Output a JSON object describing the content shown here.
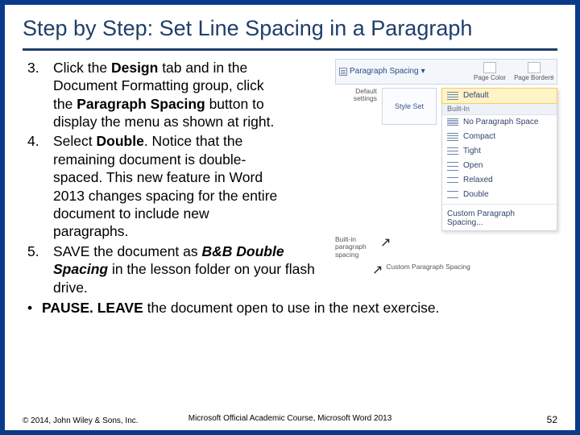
{
  "title": "Step by Step: Set Line Spacing in a Paragraph",
  "steps": [
    {
      "num": "3.",
      "segments": [
        {
          "t": "Click the "
        },
        {
          "t": "Design",
          "b": true
        },
        {
          "t": " tab and in the Document Formatting group, click the "
        },
        {
          "t": "Paragraph Spacing",
          "b": true
        },
        {
          "t": " button to display the menu as shown at right."
        }
      ],
      "narrow": true
    },
    {
      "num": "4.",
      "segments": [
        {
          "t": "Select "
        },
        {
          "t": "Double",
          "b": true
        },
        {
          "t": ". Notice that the remaining document is double-spaced. This new feature in Word 2013 changes spacing for the entire document to include new paragraphs."
        }
      ],
      "narrow": true
    },
    {
      "num": "5.",
      "segments": [
        {
          "t": " SAVE the document as "
        },
        {
          "t": "B&B Double Spacing",
          "bi": true
        },
        {
          "t": " in the lesson folder on your flash drive."
        }
      ],
      "narrow": false
    }
  ],
  "pause_segments": [
    {
      "t": "PAUSE. LEAVE ",
      "b": true
    },
    {
      "t": "the document open to use in the next exercise."
    }
  ],
  "footer": {
    "left": "© 2014, John Wiley & Sons, Inc.",
    "center": "Microsoft Official Academic Course, Microsoft Word 2013",
    "page": "52"
  },
  "shot": {
    "paragraph_spacing_btn": "Paragraph Spacing",
    "ribbon_items": [
      "Page Color",
      "Page Borders"
    ],
    "default_label": "Default settings",
    "style_set": "Style Set",
    "default_opt": "Default",
    "builtin_header": "Built-In",
    "options": [
      "No Paragraph Space",
      "Compact",
      "Tight",
      "Open",
      "Relaxed",
      "Double"
    ],
    "custom": "Custom Paragraph Spacing...",
    "callout_a": "Built-in paragraph spacing",
    "callout_b": "Custom Paragraph Spacing"
  }
}
